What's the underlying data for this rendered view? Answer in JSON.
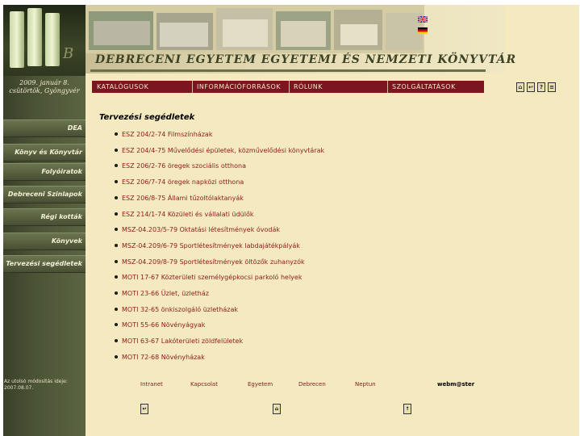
{
  "header": {
    "title": "DEBRECENI EGYETEM EGYETEMI ÉS NEMZETI KÖNYVTÁR",
    "flags": [
      "english-flag-icon",
      "german-flag-icon"
    ]
  },
  "sidebar": {
    "date_line1": "2009. január 8.",
    "date_line2": "csütörtök, Gyöngyvér",
    "items": [
      {
        "label": "DEA"
      },
      {
        "label": "Könyv és Könyvtár"
      },
      {
        "label": "Folyóiratok"
      },
      {
        "label": "Debreceni Szinlapok"
      },
      {
        "label": "Régi kották"
      },
      {
        "label": "Könyvek"
      },
      {
        "label": "Tervezési segédletek"
      }
    ],
    "last_modified_label": "Az utolsó módosítás ideje:",
    "last_modified_date": "2007.08.07."
  },
  "nav": {
    "items": [
      {
        "label": "KATALÓGUSOK"
      },
      {
        "label": "INFORMÁCIÓFORRÁSOK"
      },
      {
        "label": "RÓLUNK"
      },
      {
        "label": "SZOLGÁLTATÁSOK"
      }
    ],
    "tools": [
      "home-icon",
      "back-icon",
      "help-icon",
      "print-icon"
    ]
  },
  "content": {
    "title": "Tervezési segédletek",
    "items": [
      "ESZ 204/2-74 Filmszínházak",
      "ESZ 204/4-75 Művelődési épületek, közművelődési könyvtárak",
      "ESZ 206/2-76 öregek szociális otthona",
      "ESZ 206/7-74 öregek napközi otthona",
      "ESZ 206/8-75 Állami tűzoltólaktanyák",
      "ESZ 214/1-74 Közületi és vállalati üdülők",
      "MSZ-04.203/5-79 Oktatási létesítmények óvodák",
      "MSZ-04.209/6-79 Sportlétesítmények labdajátékpályák",
      "MSZ-04.209/8-79 Sportlétesítmények öltözők zuhanyzók",
      "MOTI 17-67 Közterületi személygépkocsi parkoló helyek",
      "MOTI 23-66 Üzlet, üzletház",
      "MOTI 32-65 önkiszolgáló üzletházak",
      "MOTI 55-66 Növényágyak",
      "MOTI 63-67 Lakóterületi zöldfelületek",
      "MOTI 72-68 Növényházak"
    ]
  },
  "footer": {
    "links": [
      "Intranet",
      "Kapcsolat",
      "Egyetem",
      "Debrecen",
      "Neptun"
    ],
    "webmaster": "webm@ster",
    "icons": [
      "back-icon",
      "home-icon",
      "up-icon"
    ]
  }
}
